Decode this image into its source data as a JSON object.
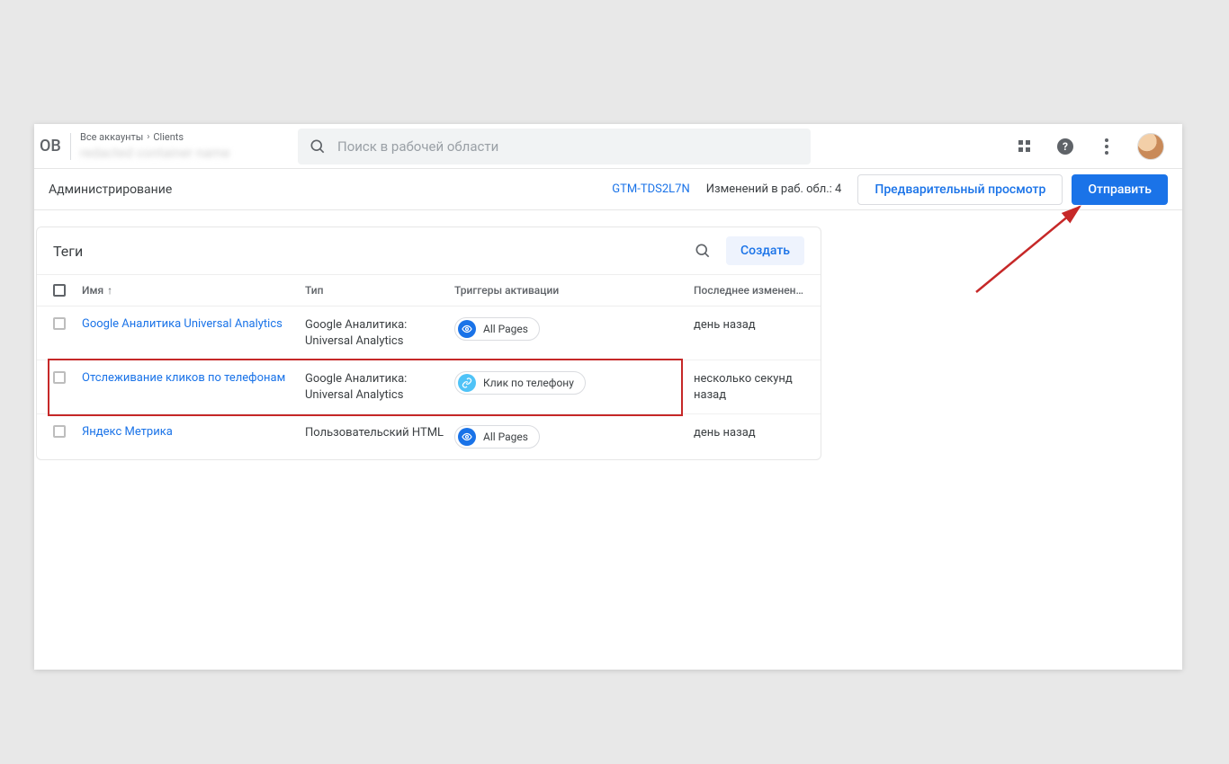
{
  "header": {
    "logo_fragment": "ОВ",
    "breadcrumb": {
      "root": "Все аккаунты",
      "leaf": "Clients"
    },
    "account_name_blurred": "redacted container name",
    "search_placeholder": "Поиск в рабочей области"
  },
  "subheader": {
    "admin_label": "Администрирование",
    "container_id": "GTM-TDS2L7N",
    "changes_label": "Изменений в раб. обл.: 4",
    "preview_button": "Предварительный просмотр",
    "submit_button": "Отправить"
  },
  "panel": {
    "title": "Теги",
    "create_button": "Создать",
    "columns": {
      "name": "Имя",
      "type": "Тип",
      "triggers": "Триггеры активации",
      "modified": "Последнее изменен…"
    },
    "rows": [
      {
        "name": "Google Аналитика Universal Analytics",
        "type": "Google Аналитика: Universal Analytics",
        "trigger": {
          "icon": "eye",
          "label": "All Pages"
        },
        "modified": "день назад",
        "highlighted": false
      },
      {
        "name": "Отслеживание кликов по телефонам",
        "type": "Google Аналитика: Universal Analytics",
        "trigger": {
          "icon": "link",
          "label": "Клик по телефону"
        },
        "modified": "несколько секунд назад",
        "highlighted": true
      },
      {
        "name": "Яндекс Метрика",
        "type": "Пользовательский HTML",
        "trigger": {
          "icon": "eye",
          "label": "All Pages"
        },
        "modified": "день назад",
        "highlighted": false
      }
    ]
  }
}
